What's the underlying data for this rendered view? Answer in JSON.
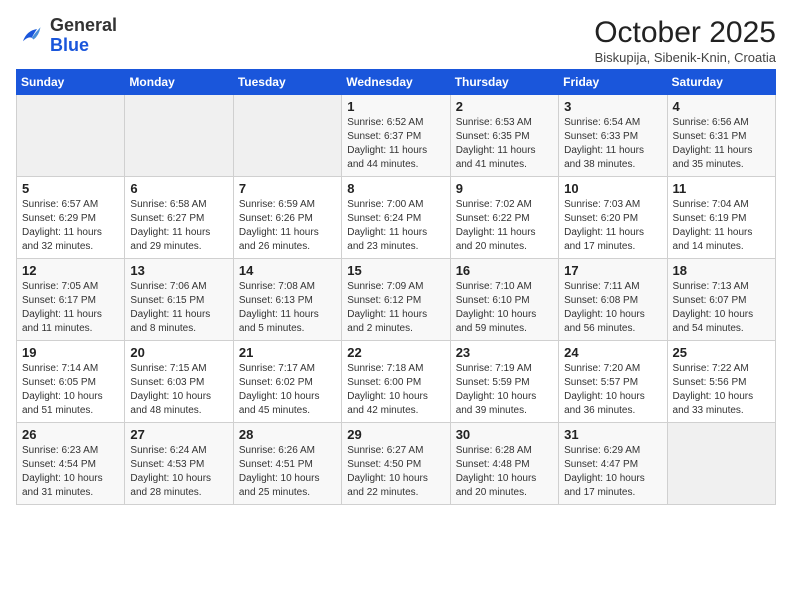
{
  "header": {
    "logo_general": "General",
    "logo_blue": "Blue",
    "month_title": "October 2025",
    "subtitle": "Biskupija, Sibenik-Knin, Croatia"
  },
  "days_of_week": [
    "Sunday",
    "Monday",
    "Tuesday",
    "Wednesday",
    "Thursday",
    "Friday",
    "Saturday"
  ],
  "weeks": [
    [
      {
        "day": "",
        "info": ""
      },
      {
        "day": "",
        "info": ""
      },
      {
        "day": "",
        "info": ""
      },
      {
        "day": "1",
        "info": "Sunrise: 6:52 AM\nSunset: 6:37 PM\nDaylight: 11 hours and 44 minutes."
      },
      {
        "day": "2",
        "info": "Sunrise: 6:53 AM\nSunset: 6:35 PM\nDaylight: 11 hours and 41 minutes."
      },
      {
        "day": "3",
        "info": "Sunrise: 6:54 AM\nSunset: 6:33 PM\nDaylight: 11 hours and 38 minutes."
      },
      {
        "day": "4",
        "info": "Sunrise: 6:56 AM\nSunset: 6:31 PM\nDaylight: 11 hours and 35 minutes."
      }
    ],
    [
      {
        "day": "5",
        "info": "Sunrise: 6:57 AM\nSunset: 6:29 PM\nDaylight: 11 hours and 32 minutes."
      },
      {
        "day": "6",
        "info": "Sunrise: 6:58 AM\nSunset: 6:27 PM\nDaylight: 11 hours and 29 minutes."
      },
      {
        "day": "7",
        "info": "Sunrise: 6:59 AM\nSunset: 6:26 PM\nDaylight: 11 hours and 26 minutes."
      },
      {
        "day": "8",
        "info": "Sunrise: 7:00 AM\nSunset: 6:24 PM\nDaylight: 11 hours and 23 minutes."
      },
      {
        "day": "9",
        "info": "Sunrise: 7:02 AM\nSunset: 6:22 PM\nDaylight: 11 hours and 20 minutes."
      },
      {
        "day": "10",
        "info": "Sunrise: 7:03 AM\nSunset: 6:20 PM\nDaylight: 11 hours and 17 minutes."
      },
      {
        "day": "11",
        "info": "Sunrise: 7:04 AM\nSunset: 6:19 PM\nDaylight: 11 hours and 14 minutes."
      }
    ],
    [
      {
        "day": "12",
        "info": "Sunrise: 7:05 AM\nSunset: 6:17 PM\nDaylight: 11 hours and 11 minutes."
      },
      {
        "day": "13",
        "info": "Sunrise: 7:06 AM\nSunset: 6:15 PM\nDaylight: 11 hours and 8 minutes."
      },
      {
        "day": "14",
        "info": "Sunrise: 7:08 AM\nSunset: 6:13 PM\nDaylight: 11 hours and 5 minutes."
      },
      {
        "day": "15",
        "info": "Sunrise: 7:09 AM\nSunset: 6:12 PM\nDaylight: 11 hours and 2 minutes."
      },
      {
        "day": "16",
        "info": "Sunrise: 7:10 AM\nSunset: 6:10 PM\nDaylight: 10 hours and 59 minutes."
      },
      {
        "day": "17",
        "info": "Sunrise: 7:11 AM\nSunset: 6:08 PM\nDaylight: 10 hours and 56 minutes."
      },
      {
        "day": "18",
        "info": "Sunrise: 7:13 AM\nSunset: 6:07 PM\nDaylight: 10 hours and 54 minutes."
      }
    ],
    [
      {
        "day": "19",
        "info": "Sunrise: 7:14 AM\nSunset: 6:05 PM\nDaylight: 10 hours and 51 minutes."
      },
      {
        "day": "20",
        "info": "Sunrise: 7:15 AM\nSunset: 6:03 PM\nDaylight: 10 hours and 48 minutes."
      },
      {
        "day": "21",
        "info": "Sunrise: 7:17 AM\nSunset: 6:02 PM\nDaylight: 10 hours and 45 minutes."
      },
      {
        "day": "22",
        "info": "Sunrise: 7:18 AM\nSunset: 6:00 PM\nDaylight: 10 hours and 42 minutes."
      },
      {
        "day": "23",
        "info": "Sunrise: 7:19 AM\nSunset: 5:59 PM\nDaylight: 10 hours and 39 minutes."
      },
      {
        "day": "24",
        "info": "Sunrise: 7:20 AM\nSunset: 5:57 PM\nDaylight: 10 hours and 36 minutes."
      },
      {
        "day": "25",
        "info": "Sunrise: 7:22 AM\nSunset: 5:56 PM\nDaylight: 10 hours and 33 minutes."
      }
    ],
    [
      {
        "day": "26",
        "info": "Sunrise: 6:23 AM\nSunset: 4:54 PM\nDaylight: 10 hours and 31 minutes."
      },
      {
        "day": "27",
        "info": "Sunrise: 6:24 AM\nSunset: 4:53 PM\nDaylight: 10 hours and 28 minutes."
      },
      {
        "day": "28",
        "info": "Sunrise: 6:26 AM\nSunset: 4:51 PM\nDaylight: 10 hours and 25 minutes."
      },
      {
        "day": "29",
        "info": "Sunrise: 6:27 AM\nSunset: 4:50 PM\nDaylight: 10 hours and 22 minutes."
      },
      {
        "day": "30",
        "info": "Sunrise: 6:28 AM\nSunset: 4:48 PM\nDaylight: 10 hours and 20 minutes."
      },
      {
        "day": "31",
        "info": "Sunrise: 6:29 AM\nSunset: 4:47 PM\nDaylight: 10 hours and 17 minutes."
      },
      {
        "day": "",
        "info": ""
      }
    ]
  ]
}
